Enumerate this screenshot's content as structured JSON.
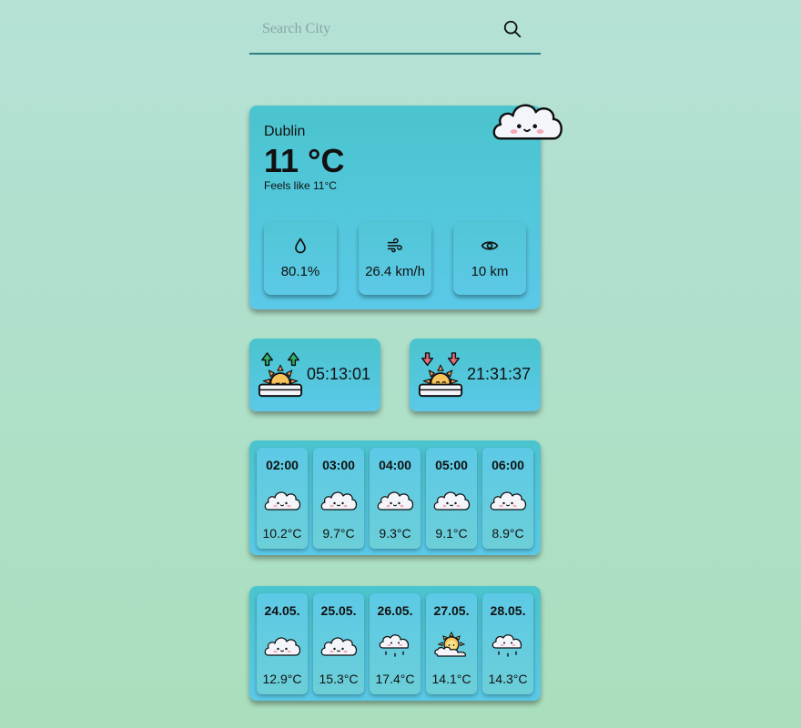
{
  "search": {
    "placeholder": "Search City"
  },
  "current": {
    "city": "Dublin",
    "temperature": "11 °C",
    "feels_like": "Feels like 11°C",
    "icon": "cloudy-icon",
    "stats": [
      {
        "icon": "humidity-drop-icon",
        "value": "80.1%"
      },
      {
        "icon": "wind-icon",
        "value": "26.4 km/h"
      },
      {
        "icon": "visibility-eye-icon",
        "value": "10 km"
      }
    ]
  },
  "sun": {
    "sunrise": {
      "icon": "sunrise-icon",
      "time": "05:13:01"
    },
    "sunset": {
      "icon": "sunset-icon",
      "time": "21:31:37"
    }
  },
  "hourly": [
    {
      "time": "02:00",
      "icon": "cloudy-icon",
      "temp": "10.2°C"
    },
    {
      "time": "03:00",
      "icon": "cloudy-icon",
      "temp": "9.7°C"
    },
    {
      "time": "04:00",
      "icon": "cloudy-icon",
      "temp": "9.3°C"
    },
    {
      "time": "05:00",
      "icon": "cloudy-icon",
      "temp": "9.1°C"
    },
    {
      "time": "06:00",
      "icon": "cloudy-icon",
      "temp": "8.9°C"
    }
  ],
  "daily": [
    {
      "date": "24.05.",
      "icon": "cloudy-icon",
      "temp": "12.9°C"
    },
    {
      "date": "25.05.",
      "icon": "cloudy-icon",
      "temp": "15.3°C"
    },
    {
      "date": "26.05.",
      "icon": "rain-cloud-icon",
      "temp": "17.4°C"
    },
    {
      "date": "27.05.",
      "icon": "sunny-icon",
      "temp": "14.1°C"
    },
    {
      "date": "28.05.",
      "icon": "rain-cloud-icon",
      "temp": "14.3°C"
    }
  ],
  "colors": {
    "card": "#4ac4cd",
    "tile": "#5cc9e6",
    "accent_line": "#2f7f86",
    "arrow_up": "#2fb36a",
    "arrow_down": "#e86b7b",
    "sun": "#f6c35a"
  }
}
